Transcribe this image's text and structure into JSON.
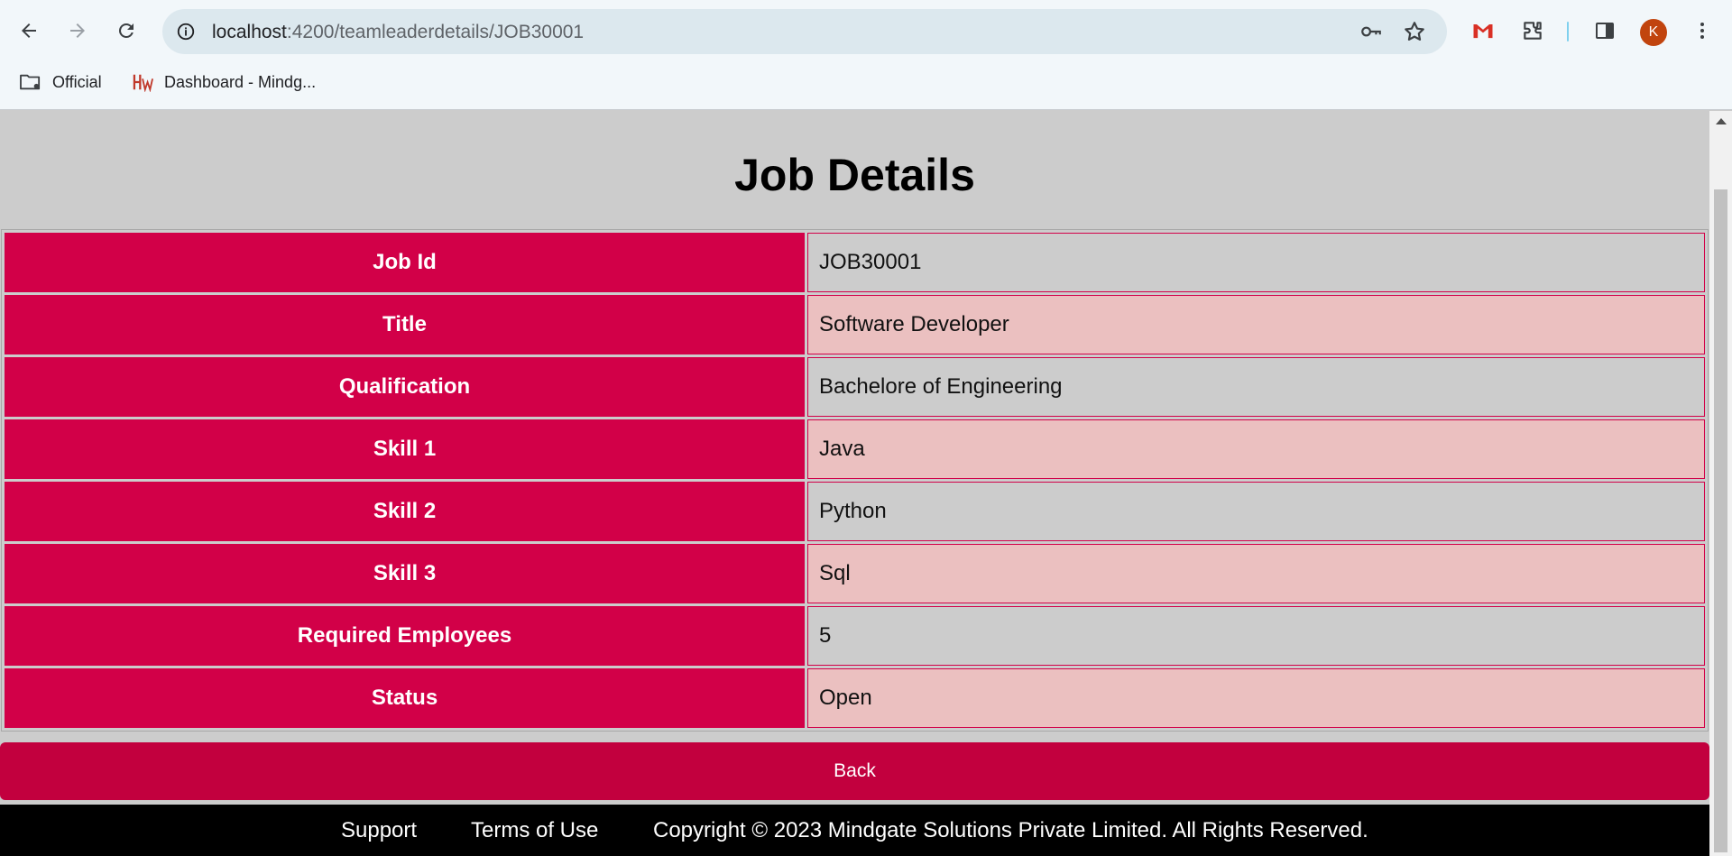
{
  "browser": {
    "url_host": "localhost",
    "url_path": ":4200/teamleaderdetails/JOB30001",
    "avatar_letter": "K",
    "bookmarks": [
      {
        "label": "Official",
        "icon": "folder-gear-icon"
      },
      {
        "label": "Dashboard - Mindg...",
        "icon": "hw-logo-icon"
      }
    ]
  },
  "page": {
    "title": "Job Details",
    "rows": [
      {
        "label": "Job Id",
        "value": "JOB30001"
      },
      {
        "label": "Title",
        "value": "Software Developer"
      },
      {
        "label": "Qualification",
        "value": "Bachelore of Engineering"
      },
      {
        "label": "Skill 1",
        "value": "Java"
      },
      {
        "label": "Skill 2",
        "value": "Python"
      },
      {
        "label": "Skill 3",
        "value": "Sql"
      },
      {
        "label": "Required Employees",
        "value": "5"
      },
      {
        "label": "Status",
        "value": "Open"
      }
    ],
    "back_label": "Back"
  },
  "footer": {
    "support": "Support",
    "terms": "Terms of Use",
    "copyright": "Copyright © 2023 Mindgate Solutions Private Limited. All Rights Reserved."
  },
  "colors": {
    "label_bg": "#d20048",
    "back_bg": "#c2003e",
    "even_row_bg": "#ebc0c0",
    "page_bg": "#cccccc",
    "footer_bg": "#000000"
  }
}
